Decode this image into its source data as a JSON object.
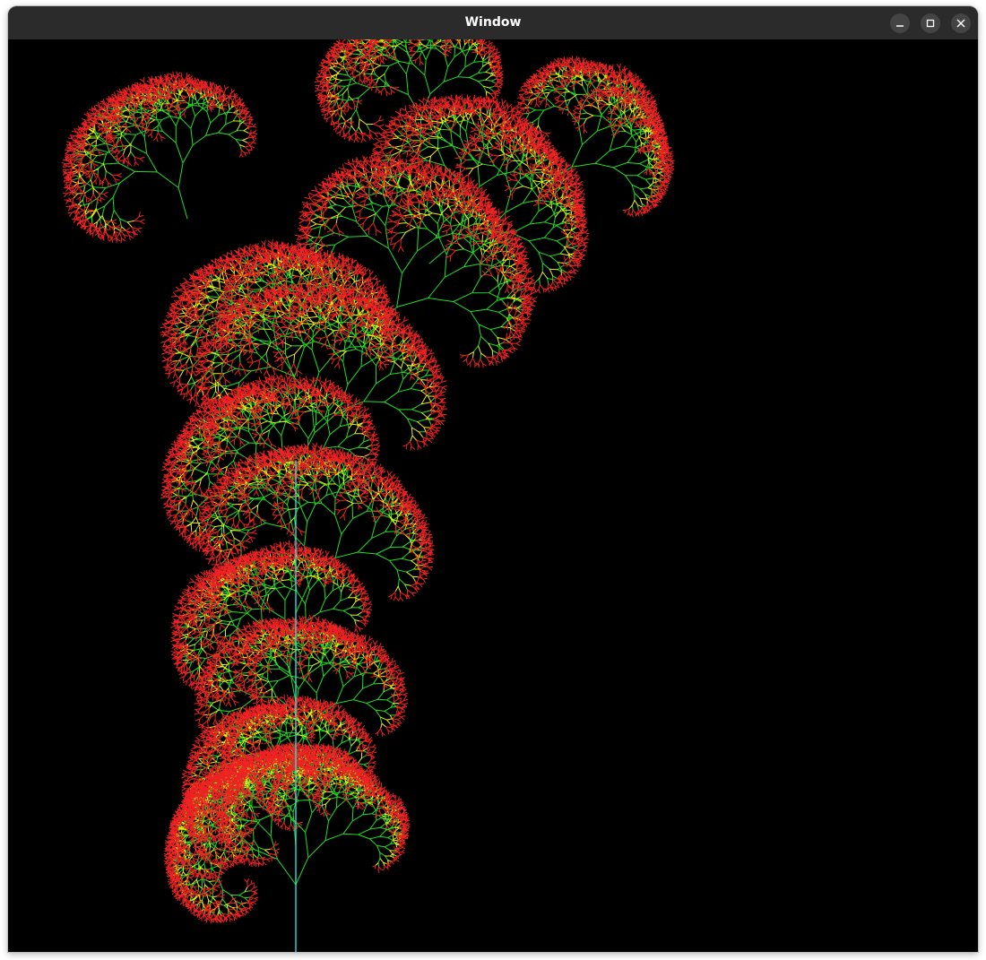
{
  "window": {
    "title": "Window",
    "controls": {
      "minimize_icon": "minimize-icon",
      "maximize_icon": "maximize-icon",
      "close_icon": "close-icon"
    }
  },
  "canvas": {
    "background": "#000000",
    "colors": {
      "trunk": "#22e0e0",
      "branch": "#22dd22",
      "young": "#eeee11",
      "tip": "#ee2222"
    }
  }
}
